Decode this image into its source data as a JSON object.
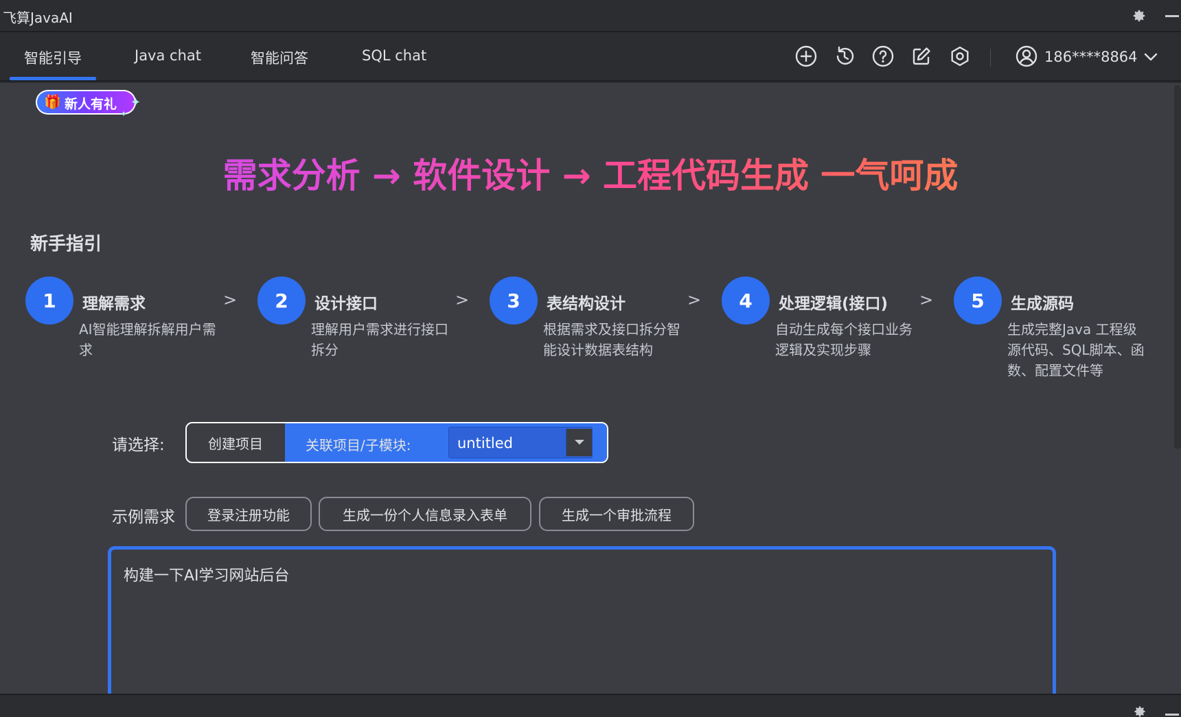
{
  "window": {
    "title": "飞算JavaAI"
  },
  "nav": {
    "tabs": [
      {
        "label": "智能引导",
        "active": true
      },
      {
        "label": "Java chat"
      },
      {
        "label": "智能问答"
      },
      {
        "label": "SQL chat"
      }
    ],
    "icons": [
      "add-circle-icon",
      "history-icon",
      "help-icon",
      "edit-icon",
      "settings-hex-icon"
    ],
    "user": {
      "name": "186****8864",
      "icon": "user-icon"
    }
  },
  "promo": {
    "label": "新人有礼",
    "icon": "gift-icon"
  },
  "slogan": "需求分析 → 软件设计 → 工程代码生成 一气呵成",
  "guide": {
    "title": "新手指引",
    "steps": [
      {
        "num": "1",
        "title": "理解需求",
        "desc": "AI智能理解拆解用户需求"
      },
      {
        "num": "2",
        "title": "设计接口",
        "desc": "理解用户需求进行接口拆分"
      },
      {
        "num": "3",
        "title": "表结构设计",
        "desc": "根据需求及接口拆分智能设计数据表结构"
      },
      {
        "num": "4",
        "title": "处理逻辑(接口)",
        "desc": "自动生成每个接口业务逻辑及实现步骤"
      },
      {
        "num": "5",
        "title": "生成源码",
        "desc": "生成完整Java 工程级源代码、SQL脚本、函数、配置文件等"
      }
    ],
    "arrow": ">"
  },
  "selection": {
    "label": "请选择:",
    "create_label": "创建项目",
    "link_label": "关联项目/子模块:",
    "project_value": "untitled"
  },
  "examples": {
    "label": "示例需求",
    "chips": [
      "登录注册功能",
      "生成一份个人信息录入表单",
      "生成一个审批流程"
    ]
  },
  "input": {
    "value": "构建一下AI学习网站后台"
  },
  "colors": {
    "accent": "#3574f0",
    "background": "#3b3d42",
    "chrome": "#2b2d30"
  }
}
